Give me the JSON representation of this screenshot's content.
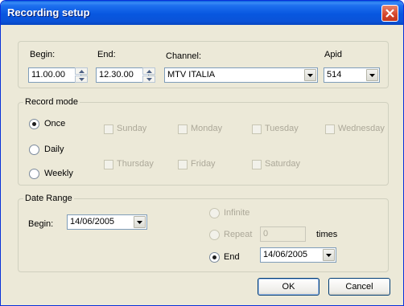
{
  "window": {
    "title": "Recording setup"
  },
  "schedule": {
    "begin_label": "Begin:",
    "begin_value": "11.00.00",
    "end_label": "End:",
    "end_value": "12.30.00",
    "channel_label": "Channel:",
    "channel_value": "MTV ITALIA",
    "apid_label": "Apid",
    "apid_value": "514"
  },
  "record_mode": {
    "legend": "Record mode",
    "options": [
      {
        "label": "Once",
        "checked": true
      },
      {
        "label": "Daily",
        "checked": false
      },
      {
        "label": "Weekly",
        "checked": false
      }
    ],
    "days": [
      {
        "label": "Sunday"
      },
      {
        "label": "Monday"
      },
      {
        "label": "Tuesday"
      },
      {
        "label": "Wednesday"
      },
      {
        "label": "Thursday"
      },
      {
        "label": "Friday"
      },
      {
        "label": "Saturday"
      }
    ]
  },
  "date_range": {
    "legend": "Date Range",
    "begin_label": "Begin:",
    "begin_value": "14/06/2005",
    "infinite_label": "Infinite",
    "repeat_label": "Repeat",
    "repeat_value": "0",
    "times_label": "times",
    "end_label": "End",
    "end_value": "14/06/2005"
  },
  "buttons": {
    "ok": "OK",
    "cancel": "Cancel"
  },
  "colors": {
    "title_bar": "#0a53d8",
    "dialog_bg": "#ece9d8",
    "close_button": "#d5452a",
    "disabled_text": "#aca899"
  }
}
